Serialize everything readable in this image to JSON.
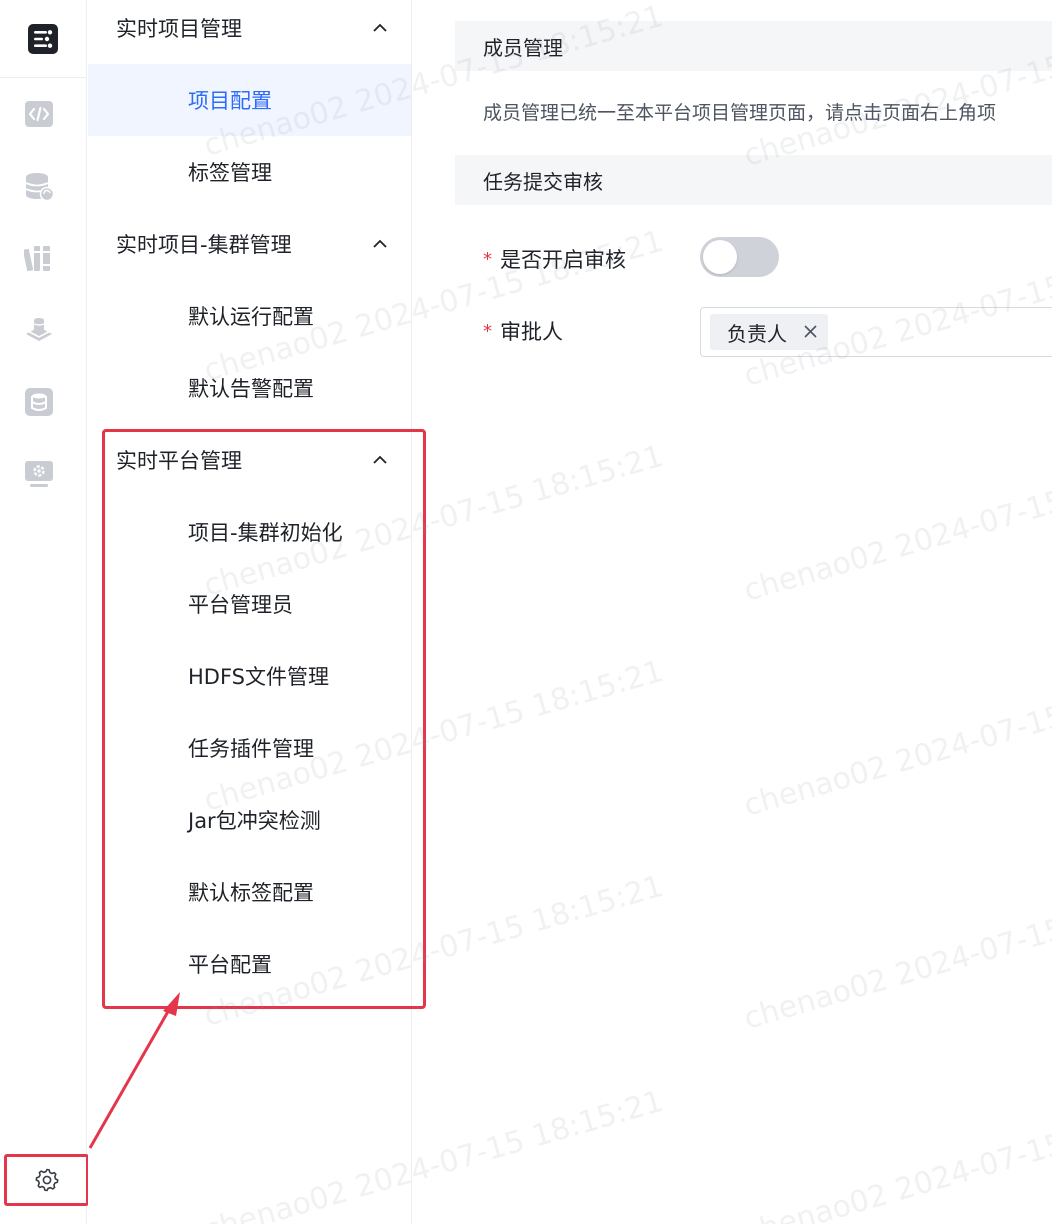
{
  "sidebar": {
    "icons": [
      "app-logo-icon",
      "code-icon",
      "database-sync-icon",
      "books-icon",
      "layers-icon",
      "storage-icon",
      "monitor-settings-icon"
    ],
    "settings_icon": "gear-icon"
  },
  "menu": {
    "groups": [
      {
        "title": "实时项目管理",
        "items": [
          {
            "label": "项目配置",
            "active": true
          },
          {
            "label": "标签管理"
          }
        ]
      },
      {
        "title": "实时项目-集群管理",
        "items": [
          {
            "label": "默认运行配置"
          },
          {
            "label": "默认告警配置"
          }
        ]
      },
      {
        "title": "实时平台管理",
        "items": [
          {
            "label": "项目-集群初始化"
          },
          {
            "label": "平台管理员"
          },
          {
            "label": "HDFS文件管理"
          },
          {
            "label": "任务插件管理"
          },
          {
            "label": "Jar包冲突检测"
          },
          {
            "label": "默认标签配置"
          },
          {
            "label": "平台配置"
          }
        ]
      }
    ]
  },
  "main": {
    "member_section": {
      "title": "成员管理",
      "description": "成员管理已统一至本平台项目管理页面，请点击页面右上角项"
    },
    "review_section": {
      "title": "任务提交审核",
      "fields": {
        "enable_review": {
          "required_mark": "*",
          "label": "是否开启审核",
          "enabled": false
        },
        "approver": {
          "required_mark": "*",
          "label": "审批人",
          "selected_tag": "负责人",
          "tag_close": "close-icon"
        }
      }
    }
  },
  "watermark": {
    "text": "chenao02 2024-07-15 18:15:21"
  },
  "colors": {
    "accent": "#2d6cf6",
    "highlight": "#e5354a",
    "active_bg": "#f1f5ff",
    "section_bg": "#f5f6f8"
  }
}
